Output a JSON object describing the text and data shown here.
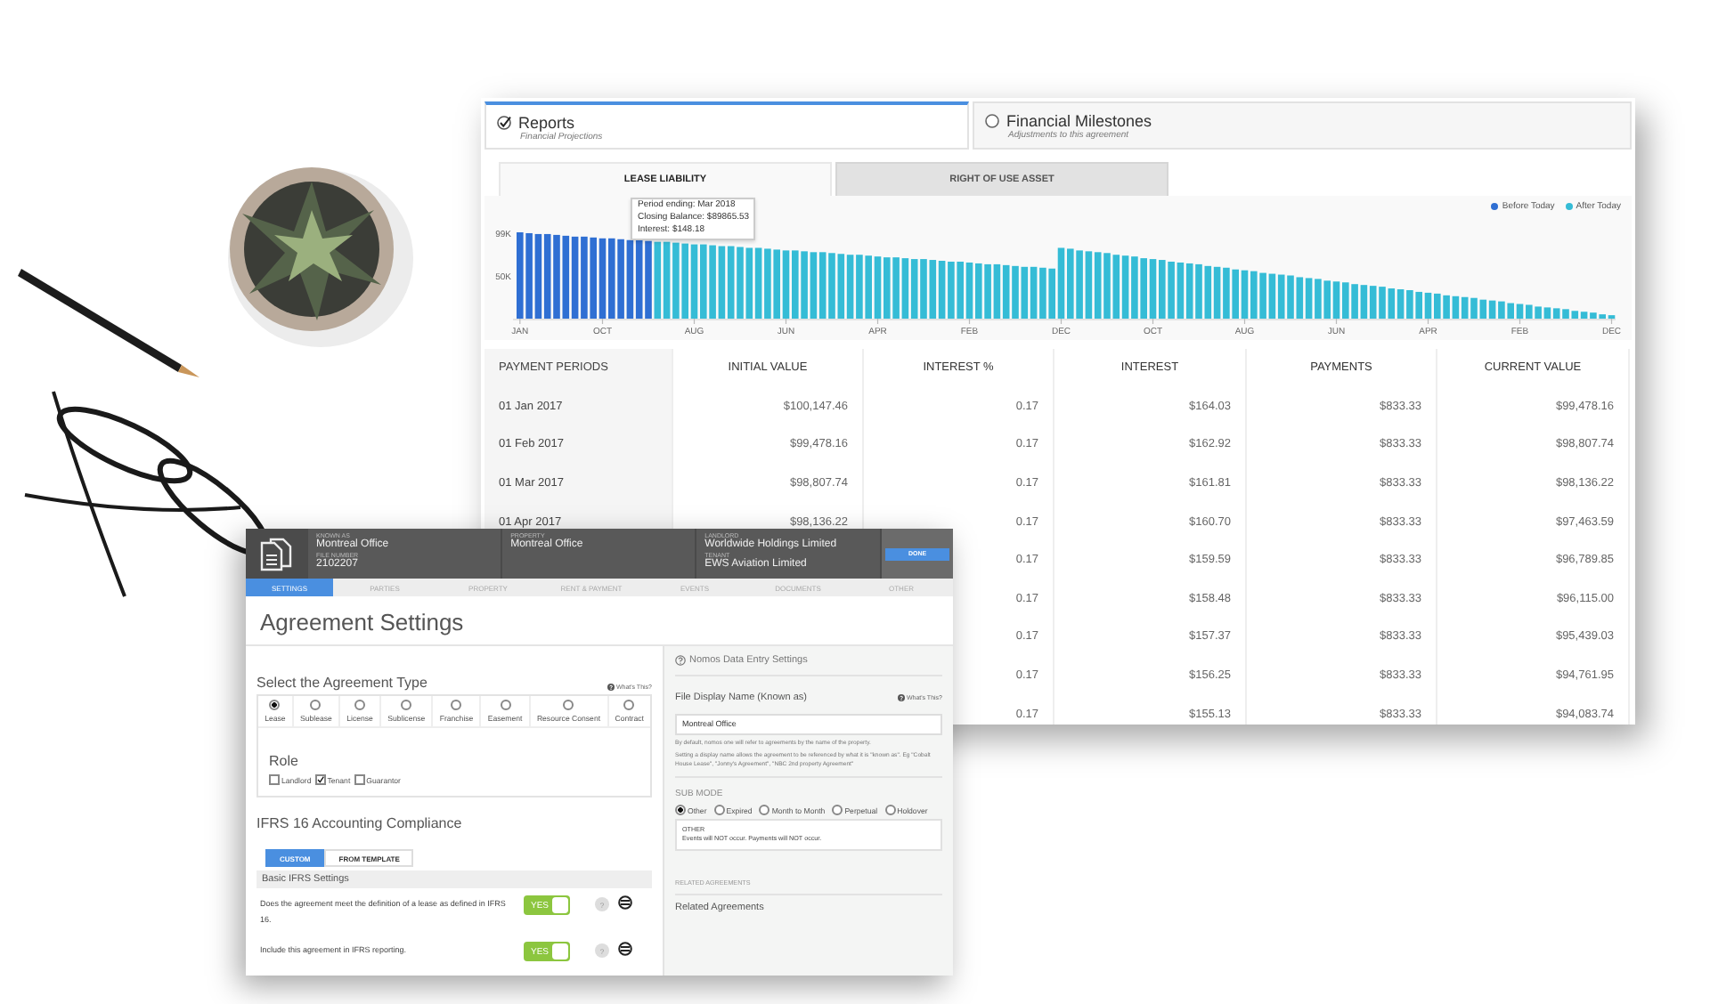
{
  "reports_window": {
    "view_tabs": [
      {
        "title": "Reports",
        "subtitle": "Financial Projections",
        "selected": true
      },
      {
        "title": "Financial Milestones",
        "subtitle": "Adjustments to this agreement",
        "selected": false
      }
    ],
    "chart_tabs": [
      {
        "label": "LEASE LIABILITY",
        "selected": true
      },
      {
        "label": "RIGHT OF USE ASSET",
        "selected": false
      }
    ],
    "chart_data": {
      "type": "bar",
      "ylim": [
        0,
        100
      ],
      "legend": "upper right",
      "categories": [
        "JAN",
        null,
        null,
        null,
        null,
        null,
        null,
        null,
        null,
        "OCT",
        null,
        null,
        null,
        null,
        null,
        null,
        null,
        null,
        null,
        "AUG",
        null,
        null,
        null,
        null,
        null,
        null,
        null,
        null,
        null,
        "JUN",
        null,
        null,
        null,
        null,
        null,
        null,
        null,
        null,
        null,
        "APR",
        null,
        null,
        null,
        null,
        null,
        null,
        null,
        null,
        null,
        "FEB",
        null,
        null,
        null,
        null,
        null,
        null,
        null,
        null,
        null,
        "DEC",
        null,
        null,
        null,
        null,
        null,
        null,
        null,
        null,
        null,
        "OCT",
        null,
        null,
        null,
        null,
        null,
        null,
        null,
        null,
        null,
        "AUG",
        null,
        null,
        null,
        null,
        null,
        null,
        null,
        null,
        null,
        "JUN",
        null,
        null,
        null,
        null,
        null,
        null,
        null,
        null,
        null,
        "APR",
        null,
        null,
        null,
        null,
        null,
        null,
        null,
        null,
        null,
        "FEB",
        null,
        null,
        null,
        null,
        null,
        null,
        null,
        null,
        null,
        "DEC"
      ],
      "yticks": [
        {
          "value": 50,
          "label": "50K"
        },
        {
          "value": 99,
          "label": "99K"
        }
      ],
      "series": [
        {
          "name": "Before Today",
          "color": "#2f6fd3",
          "values": [
            100,
            99,
            98,
            98,
            97,
            96,
            95,
            95,
            94,
            93,
            93,
            92,
            91,
            91,
            90,
            null,
            null,
            null,
            null,
            null,
            null,
            null,
            null,
            null,
            null,
            null,
            null,
            null,
            null,
            null,
            null,
            null,
            null,
            null,
            null,
            null,
            null,
            null,
            null,
            null,
            null,
            null,
            null,
            null,
            null,
            null,
            null,
            null,
            null,
            null,
            null,
            null,
            null,
            null,
            null,
            null,
            null,
            null,
            null,
            null,
            null,
            null,
            null,
            null,
            null,
            null,
            null,
            null,
            null,
            null,
            null,
            null,
            null,
            null,
            null,
            null,
            null,
            null,
            null,
            null,
            null,
            null,
            null,
            null,
            null,
            null,
            null,
            null,
            null,
            null,
            null,
            null,
            null,
            null,
            null,
            null,
            null,
            null,
            null,
            null,
            null,
            null,
            null,
            null,
            null,
            null,
            null,
            null,
            null,
            null,
            null,
            null,
            null,
            null,
            null,
            null,
            null,
            null,
            null,
            null
          ]
        },
        {
          "name": "After Today",
          "color": "#35bcd6",
          "values": [
            null,
            null,
            null,
            null,
            null,
            null,
            null,
            null,
            null,
            null,
            null,
            null,
            null,
            null,
            null,
            89,
            89,
            88,
            87,
            86,
            86,
            85,
            84,
            84,
            83,
            82,
            82,
            81,
            80,
            79,
            79,
            78,
            77,
            77,
            76,
            75,
            74,
            74,
            73,
            72,
            71,
            71,
            70,
            69,
            69,
            68,
            67,
            66,
            66,
            65,
            64,
            63,
            63,
            62,
            61,
            60,
            60,
            59,
            58,
            82,
            81,
            79,
            78,
            77,
            76,
            74,
            73,
            72,
            70,
            69,
            68,
            66,
            65,
            64,
            63,
            61,
            60,
            59,
            57,
            56,
            55,
            53,
            52,
            51,
            50,
            48,
            47,
            46,
            44,
            43,
            42,
            40,
            39,
            38,
            37,
            35,
            34,
            33,
            31,
            30,
            29,
            27,
            26,
            25,
            24,
            22,
            21,
            20,
            18,
            17,
            16,
            14,
            13,
            12,
            11,
            9,
            8,
            7,
            5,
            4
          ]
        }
      ]
    },
    "tooltip": {
      "lines": [
        "Period ending: Mar 2018",
        "Closing Balance: $89865.53",
        "Interest: $148.18"
      ]
    },
    "table": {
      "columns": [
        "PAYMENT PERIODS",
        "INITIAL VALUE",
        "INTEREST %",
        "INTEREST",
        "PAYMENTS",
        "CURRENT VALUE"
      ],
      "rows": [
        {
          "period": "01 Jan 2017",
          "initial_value": "$100,147.46",
          "interest_pct": "0.17",
          "interest": "$164.03",
          "payments": "$833.33",
          "current_value": "$99,478.16"
        },
        {
          "period": "01 Feb 2017",
          "initial_value": "$99,478.16",
          "interest_pct": "0.17",
          "interest": "$162.92",
          "payments": "$833.33",
          "current_value": "$98,807.74"
        },
        {
          "period": "01 Mar 2017",
          "initial_value": "$98,807.74",
          "interest_pct": "0.17",
          "interest": "$161.81",
          "payments": "$833.33",
          "current_value": "$98,136.22"
        },
        {
          "period": "01 Apr 2017",
          "initial_value": "$98,136.22",
          "interest_pct": "0.17",
          "interest": "$160.70",
          "payments": "$833.33",
          "current_value": "$97,463.59"
        },
        {
          "interest_pct": "0.17",
          "interest": "$159.59",
          "payments": "$833.33",
          "current_value": "$96,789.85"
        },
        {
          "interest_pct": "0.17",
          "interest": "$158.48",
          "payments": "$833.33",
          "current_value": "$96,115.00"
        },
        {
          "interest_pct": "0.17",
          "interest": "$157.37",
          "payments": "$833.33",
          "current_value": "$95,439.03"
        },
        {
          "interest_pct": "0.17",
          "interest": "$156.25",
          "payments": "$833.33",
          "current_value": "$94,761.95"
        },
        {
          "interest_pct": "0.17",
          "interest": "$155.13",
          "payments": "$833.33",
          "current_value": "$94,083.74"
        }
      ]
    }
  },
  "agreement_window": {
    "header_groups": [
      [
        {
          "label": "KNOWN AS",
          "value": "Montreal Office"
        },
        {
          "label": "FILE NUMBER",
          "value": "2102207"
        }
      ],
      [
        {
          "label": "PROPERTY",
          "value": "Montreal Office"
        }
      ],
      [
        {
          "label": "LANDLORD",
          "value": "Worldwide Holdings Limited"
        },
        {
          "label": "TENANT",
          "value": "EWS Aviation Limited"
        }
      ]
    ],
    "done_button": "DONE",
    "nav_tabs": [
      {
        "label": "SETTINGS",
        "selected": true
      },
      {
        "label": "PARTIES",
        "selected": false
      },
      {
        "label": "PROPERTY",
        "selected": false
      },
      {
        "label": "RENT & PAYMENT",
        "selected": false
      },
      {
        "label": "EVENTS",
        "selected": false
      },
      {
        "label": "DOCUMENTS",
        "selected": false
      },
      {
        "label": "OTHER",
        "selected": false
      }
    ],
    "title": "Agreement Settings",
    "agreement_type": {
      "heading": "Select the Agreement Type",
      "help": "What's This?",
      "options": [
        {
          "label": "Lease",
          "selected": true
        },
        {
          "label": "Sublease",
          "selected": false
        },
        {
          "label": "License",
          "selected": false
        },
        {
          "label": "Sublicense",
          "selected": false
        },
        {
          "label": "Franchise",
          "selected": false
        },
        {
          "label": "Easement",
          "selected": false
        },
        {
          "label": "Resource Consent",
          "selected": false
        },
        {
          "label": "Contract",
          "selected": false
        }
      ]
    },
    "role": {
      "heading": "Role",
      "options": [
        {
          "label": "Landlord",
          "checked": false
        },
        {
          "label": "Tenant",
          "checked": true
        },
        {
          "label": "Guarantor",
          "checked": false
        }
      ]
    },
    "ifrs": {
      "heading": "IFRS 16 Accounting Compliance",
      "modes": [
        {
          "label": "CUSTOM",
          "selected": true
        },
        {
          "label": "FROM TEMPLATE",
          "selected": false
        }
      ],
      "section": "Basic IFRS Settings",
      "questions": [
        {
          "text": "Does the agreement meet the definition of a lease as defined in IFRS 16.",
          "toggle": "YES",
          "on": true,
          "help": "?"
        },
        {
          "text": "Include this agreement in IFRS reporting.",
          "toggle": "YES",
          "on": true,
          "help": "?"
        }
      ]
    },
    "data_entry": {
      "heading": "Nomos Data Entry Settings",
      "field_label": "File Display Name (Known as)",
      "help": "What's This?",
      "value": "Montreal Office",
      "notes": [
        "By default, nomos one will refer to agreements by the name of the property.",
        "Setting a display name allows the agreement to be referenced by what it is \"known as\". Eg \"Cobalt House Lease\", \"Jonny's Agreement\", \"NBC 2nd property Agreement\""
      ],
      "sub_mode": {
        "heading": "SUB MODE",
        "options": [
          {
            "label": "Other",
            "selected": true
          },
          {
            "label": "Expired",
            "selected": false
          },
          {
            "label": "Month to Month",
            "selected": false
          },
          {
            "label": "Perpetual",
            "selected": false
          },
          {
            "label": "Holdover",
            "selected": false
          }
        ],
        "info_title": "OTHER",
        "info_text": "Events will NOT occur. Payments will NOT occur."
      },
      "related_heading": "RELATED AGREEMENTS",
      "related_title": "Related Agreements"
    }
  }
}
